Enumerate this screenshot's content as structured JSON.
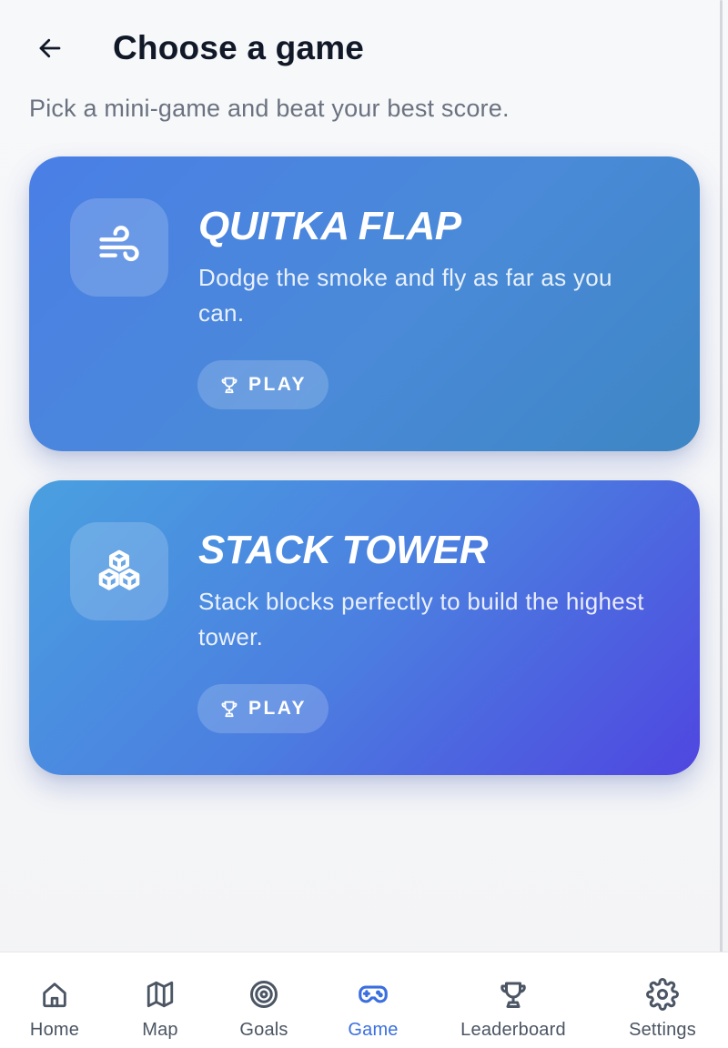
{
  "header": {
    "title": "Choose a game",
    "back_icon": "arrow-left-icon"
  },
  "subtitle": "Pick a mini-game and beat your best score.",
  "games": [
    {
      "title": "QUITKA FLAP",
      "description": "Dodge the smoke and fly as far as you can.",
      "icon": "wind-icon",
      "play_label": "PLAY",
      "play_icon": "trophy-icon"
    },
    {
      "title": "STACK TOWER",
      "description": "Stack blocks perfectly to build the highest tower.",
      "icon": "cubes-icon",
      "play_label": "PLAY",
      "play_icon": "trophy-icon"
    }
  ],
  "nav": {
    "items": [
      {
        "label": "Home",
        "icon": "home-icon"
      },
      {
        "label": "Map",
        "icon": "map-icon"
      },
      {
        "label": "Goals",
        "icon": "target-icon"
      },
      {
        "label": "Game",
        "icon": "gamepad-icon",
        "active": true
      },
      {
        "label": "Leaderboard",
        "icon": "trophy-icon"
      },
      {
        "label": "Settings",
        "icon": "gear-icon"
      }
    ]
  },
  "colors": {
    "accent": "#3b6fe0",
    "text_primary": "#111827",
    "text_secondary": "#6b7280"
  }
}
